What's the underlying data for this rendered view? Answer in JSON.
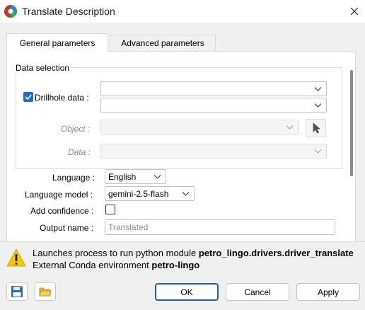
{
  "window": {
    "title": "Translate Description",
    "icon": "app-logo-icon",
    "close_icon": "close-icon"
  },
  "tabs": [
    {
      "label": "General parameters",
      "active": true
    },
    {
      "label": "Advanced parameters",
      "active": false
    }
  ],
  "data_selection": {
    "title": "Data selection",
    "drillhole": {
      "label": "Drillhole data :",
      "checked": true,
      "value1": "",
      "value2": ""
    },
    "object": {
      "label": "Object :",
      "value": "",
      "enabled": false,
      "picker_icon": "cursor-pointer-icon"
    },
    "data": {
      "label": "Data :",
      "value": "",
      "enabled": false
    }
  },
  "params": {
    "language": {
      "label": "Language :",
      "value": "English"
    },
    "language_model": {
      "label": "Language model :",
      "value": "gemini-2.5-flash"
    },
    "add_confidence": {
      "label": "Add confidence :",
      "checked": false
    },
    "output_name": {
      "label": "Output name :",
      "placeholder": "Translated"
    }
  },
  "info": {
    "icon": "warning-icon",
    "line1_prefix": "Launches process to run python module ",
    "line1_module": "petro_lingo.drivers.driver_translate",
    "line2_prefix": "External Conda environment ",
    "line2_env": "petro-lingo"
  },
  "footer": {
    "save_icon": "save-icon",
    "open_icon": "open-folder-icon",
    "ok": "OK",
    "cancel": "Cancel",
    "apply": "Apply"
  },
  "colors": {
    "accent": "#1a5fb4",
    "checkbox_checked": "#1e6ec8",
    "warning": "#f7c600"
  }
}
